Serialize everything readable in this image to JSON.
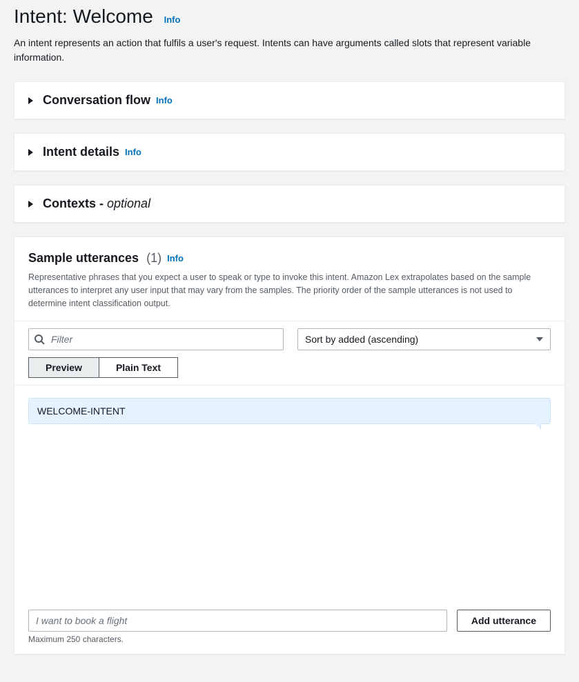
{
  "header": {
    "title": "Intent: Welcome",
    "info_label": "Info",
    "description": "An intent represents an action that fulfils a user's request. Intents can have arguments called slots that represent variable information."
  },
  "panels": {
    "conversation_flow": {
      "title": "Conversation flow",
      "info_label": "Info"
    },
    "intent_details": {
      "title": "Intent details",
      "info_label": "Info"
    },
    "contexts": {
      "title_prefix": "Contexts - ",
      "optional_label": "optional"
    }
  },
  "sample_utterances": {
    "title": "Sample utterances",
    "count": "(1)",
    "info_label": "Info",
    "description": "Representative phrases that you expect a user to speak or type to invoke this intent. Amazon Lex extrapolates based on the sample utterances to interpret any user input that may vary from the samples. The priority order of the sample utterances is not used to determine intent classification output.",
    "filter_placeholder": "Filter",
    "sort_label": "Sort by added (ascending)",
    "tabs": {
      "preview": "Preview",
      "plain_text": "Plain Text"
    },
    "items": [
      "WELCOME-INTENT"
    ],
    "add_placeholder": "I want to book a flight",
    "add_button": "Add utterance",
    "char_hint": "Maximum 250 characters."
  }
}
